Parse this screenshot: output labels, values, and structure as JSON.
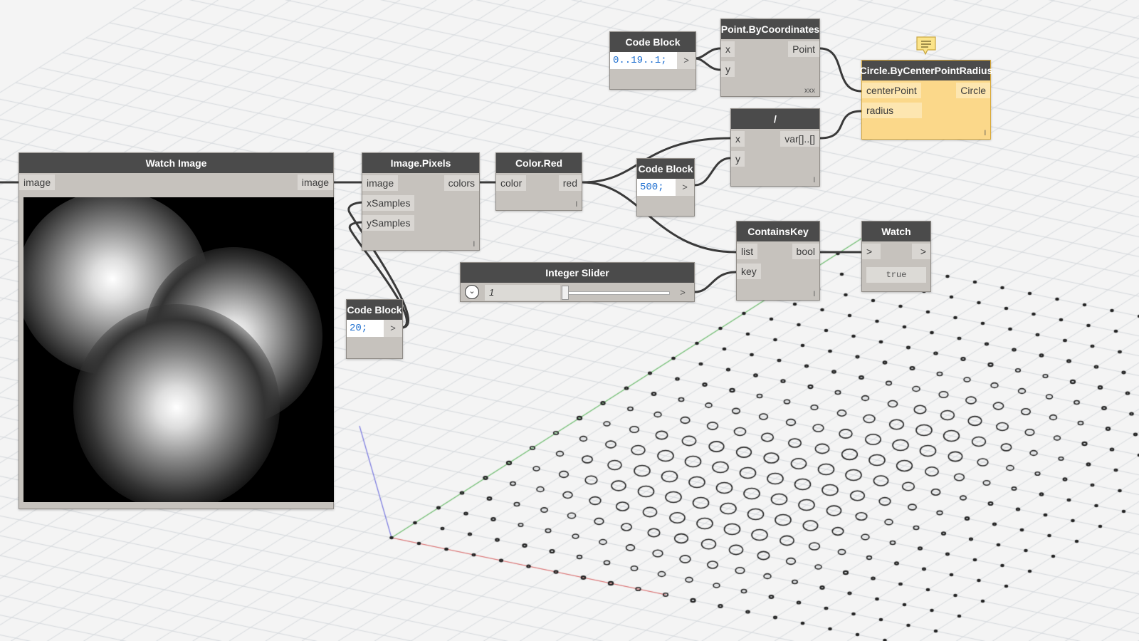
{
  "nodes": {
    "watch_image": {
      "title": "Watch Image",
      "in_port": "image",
      "out_port": "image"
    },
    "image_pixels": {
      "title": "Image.Pixels",
      "inputs": [
        "image",
        "xSamples",
        "ySamples"
      ],
      "output": "colors",
      "lacing": "l"
    },
    "color_red": {
      "title": "Color.Red",
      "input": "color",
      "output": "red",
      "lacing": "l"
    },
    "code_block_range": {
      "title": "Code Block",
      "code": "0..19..1;",
      "out": ">"
    },
    "point_by_coordinates": {
      "title": "Point.ByCoordinates",
      "inputs": [
        "x",
        "y"
      ],
      "output": "Point",
      "lacing": "xxx"
    },
    "circle_by_center_point_radius": {
      "title": "Circle.ByCenterPointRadius",
      "inputs": [
        "centerPoint",
        "radius"
      ],
      "output": "Circle",
      "lacing": "l"
    },
    "divide": {
      "title": "/",
      "inputs": [
        "x",
        "y"
      ],
      "output": "var[]..[]",
      "lacing": "l"
    },
    "code_block_500": {
      "title": "Code Block",
      "code": "500;",
      "out": ">"
    },
    "code_block_20": {
      "title": "Code Block",
      "code": "20;",
      "out": ">"
    },
    "contains_key": {
      "title": "ContainsKey",
      "inputs": [
        "list",
        "key"
      ],
      "output": "bool",
      "lacing": "l"
    },
    "integer_slider": {
      "title": "Integer Slider",
      "value": "1",
      "out": ">",
      "level": 0.0
    },
    "watch": {
      "title": "Watch",
      "in": ">",
      "out": ">",
      "value": "true"
    }
  },
  "colors": {
    "node_body": "#c6c2bd",
    "header": "#4b4b4b",
    "selected": "#fbd88a",
    "code_text": "#1e6fd0",
    "wire": "#3a3a3a"
  }
}
